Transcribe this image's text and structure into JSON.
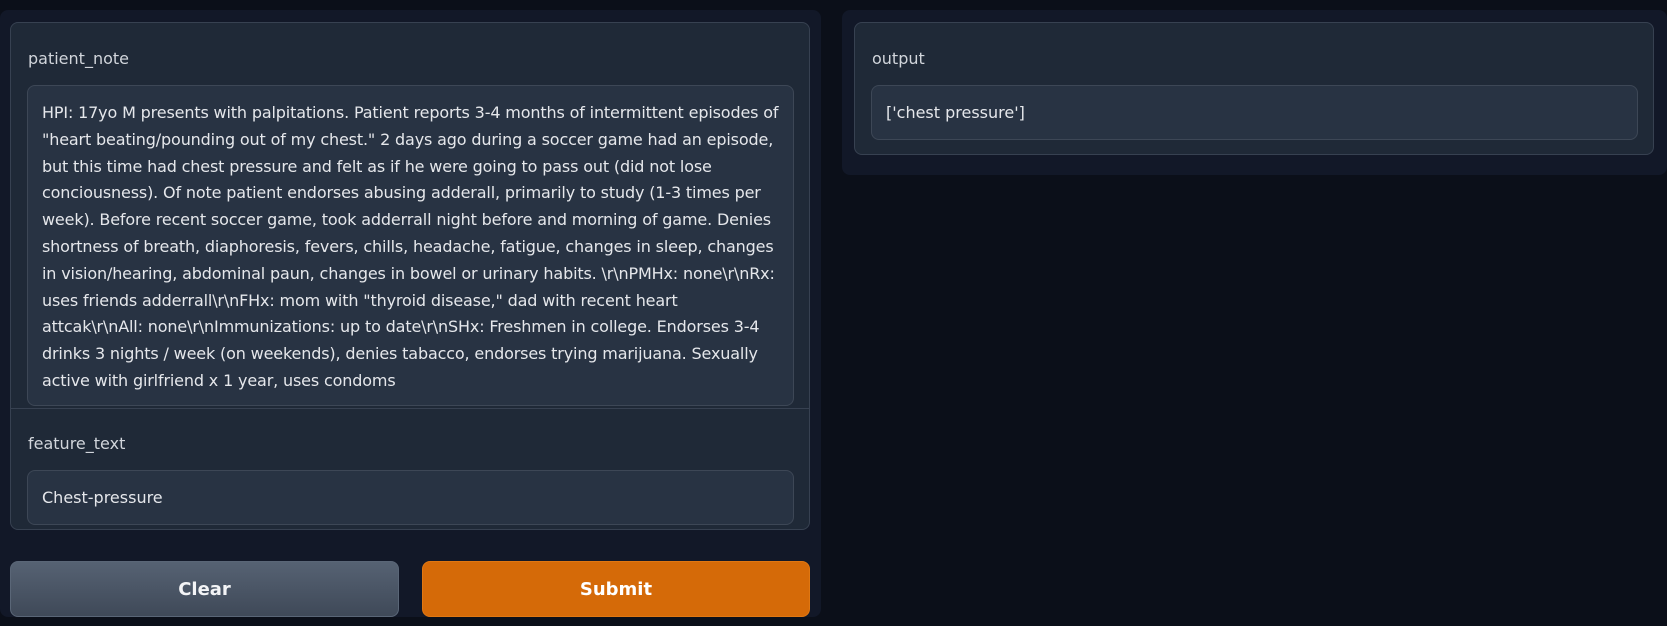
{
  "inputs": {
    "patient_note": {
      "label": "patient_note",
      "value": "HPI: 17yo M presents with palpitations. Patient reports 3-4 months of intermittent episodes of \"heart beating/pounding out of my chest.\" 2 days ago during a soccer game had an episode, but this time had chest pressure and felt as if he were going to pass out (did not lose conciousness). Of note patient endorses abusing adderall, primarily to study (1-3 times per week). Before recent soccer game, took adderrall night before and morning of game. Denies shortness of breath, diaphoresis, fevers, chills, headache, fatigue, changes in sleep, changes in vision/hearing, abdominal paun, changes in bowel or urinary habits. \\r\\nPMHx: none\\r\\nRx: uses friends adderrall\\r\\nFHx: mom with \"thyroid disease,\" dad with recent heart attcak\\r\\nAll: none\\r\\nImmunizations: up to date\\r\\nSHx: Freshmen in college. Endorses 3-4 drinks 3 nights / week (on weekends), denies tabacco, endorses trying marijuana. Sexually active with girlfriend x 1 year, uses condoms"
    },
    "feature_text": {
      "label": "feature_text",
      "value": "Chest-pressure"
    }
  },
  "buttons": {
    "clear_label": "Clear",
    "submit_label": "Submit"
  },
  "output": {
    "label": "output",
    "value": "['chest pressure']"
  },
  "colors": {
    "background": "#0b0f19",
    "panel": "#1f2937",
    "submit_accent": "#d56a08"
  }
}
